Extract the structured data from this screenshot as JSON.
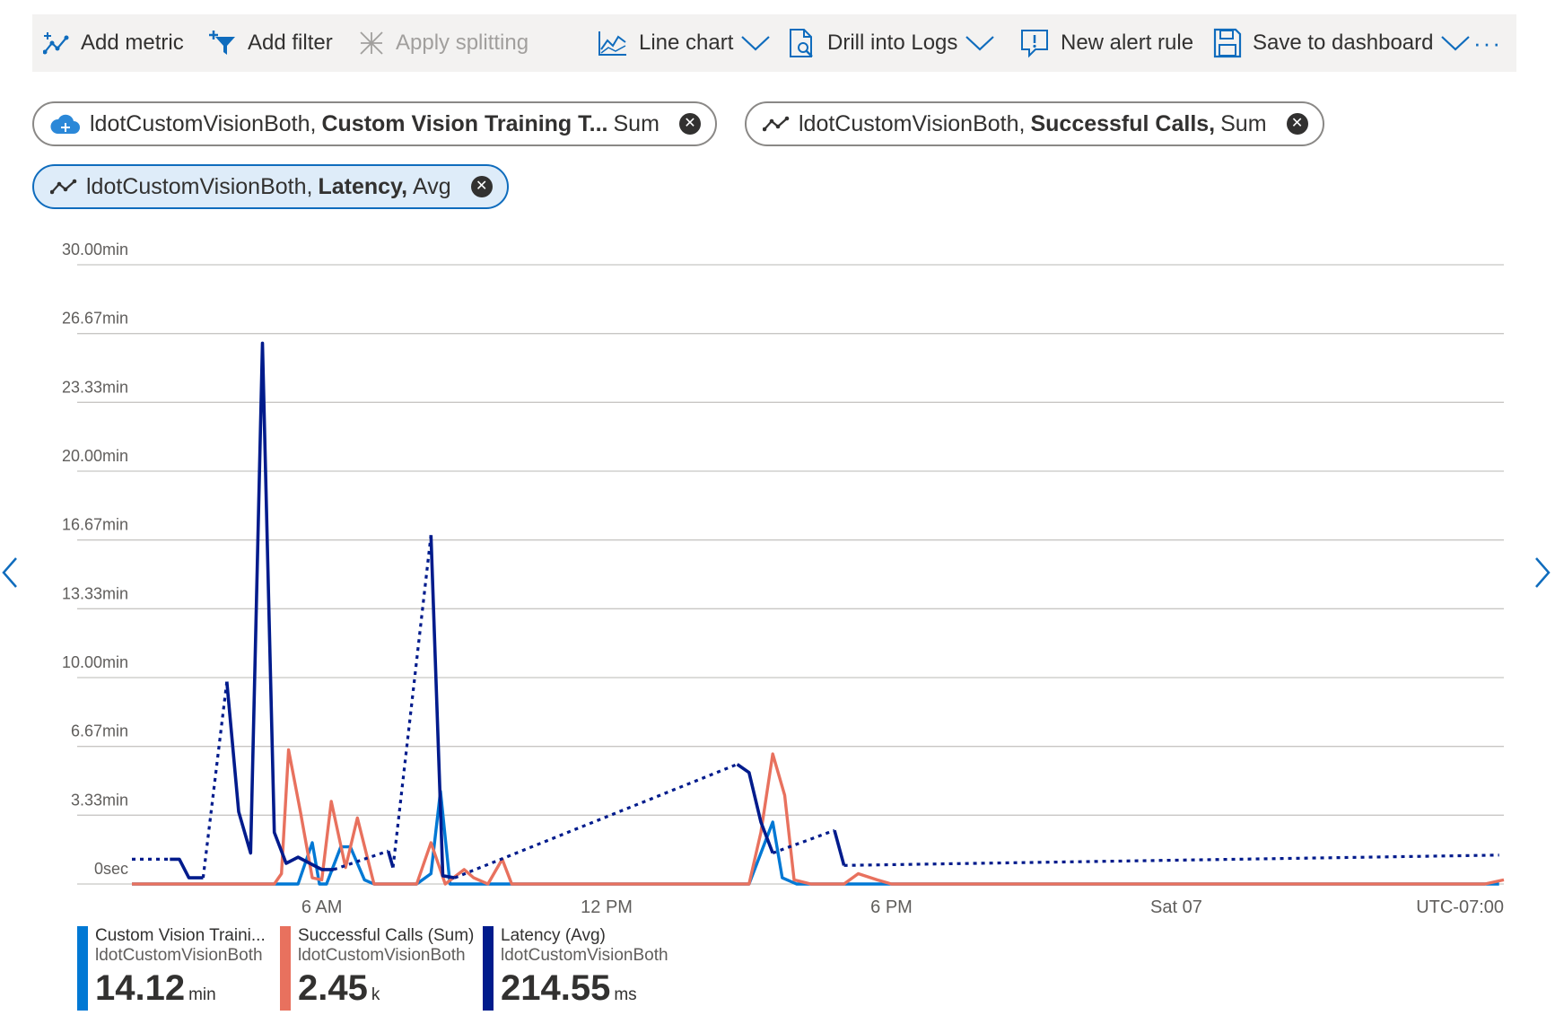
{
  "toolbar": {
    "add_metric": "Add metric",
    "add_filter": "Add filter",
    "apply_splitting": "Apply splitting",
    "line_chart": "Line chart",
    "drill_into_logs": "Drill into Logs",
    "new_alert_rule": "New alert rule",
    "save_to_dashboard": "Save to dashboard",
    "more": "···"
  },
  "pills": [
    {
      "resource": "ldotCustomVisionBoth,",
      "metric": "Custom Vision Training T...",
      "aggregation": "Sum",
      "icon": "cloud-brain-icon"
    },
    {
      "resource": "ldotCustomVisionBoth,",
      "metric": "Successful Calls,",
      "aggregation": "Sum",
      "icon": "metric-line-icon"
    },
    {
      "resource": "ldotCustomVisionBoth,",
      "metric": "Latency,",
      "aggregation": "Avg",
      "icon": "metric-line-icon"
    }
  ],
  "colors": {
    "training": "#0078d4",
    "calls": "#e8715e",
    "latency": "#001b8c",
    "grid": "#c8c6c4"
  },
  "legend": [
    {
      "name": "Custom Vision Traini...",
      "resource": "ldotCustomVisionBoth",
      "value": "14.12",
      "unit": "min"
    },
    {
      "name": "Successful Calls (Sum)",
      "resource": "ldotCustomVisionBoth",
      "value": "2.45",
      "unit": "k"
    },
    {
      "name": "Latency (Avg)",
      "resource": "ldotCustomVisionBoth",
      "value": "214.55",
      "unit": "ms"
    }
  ],
  "chart_data": {
    "type": "line",
    "y_tick_labels": [
      "0sec",
      "3.33min",
      "6.67min",
      "10.00min",
      "13.33min",
      "16.67min",
      "20.00min",
      "23.33min",
      "26.67min",
      "30.00min"
    ],
    "ylim": [
      0,
      30
    ],
    "y_unit": "min",
    "x_tick_labels": [
      "6 AM",
      "12 PM",
      "6 PM",
      "Sat 07",
      "UTC-07:00"
    ],
    "x_ticks_hours": [
      6,
      12,
      18,
      24
    ],
    "xlim_hours": [
      2,
      30.9
    ],
    "grid": true,
    "series": [
      {
        "name": "Custom Vision Training T... (Sum)",
        "style": "solid",
        "x": [
          2,
          5.5,
          5.8,
          5.95,
          6.1,
          6.4,
          6.6,
          6.9,
          7.1,
          8.0,
          8.3,
          8.5,
          8.7,
          9.0,
          9.5,
          10.0,
          15.0,
          15.5,
          15.7,
          16.0,
          17.0,
          18.0,
          30.5,
          30.8
        ],
        "y": [
          0,
          0,
          2,
          0,
          0,
          1.8,
          1.8,
          0.2,
          0,
          0,
          0.5,
          4.5,
          0,
          0,
          0,
          0,
          0,
          3,
          0.3,
          0,
          0,
          0,
          0,
          0
        ]
      },
      {
        "name": "Successful Calls (Sum)",
        "style": "solid",
        "x": [
          2,
          4.0,
          5.0,
          5.15,
          5.3,
          5.55,
          5.8,
          6.0,
          6.2,
          6.5,
          6.75,
          7.1,
          7.5,
          8.0,
          8.3,
          8.6,
          9.0,
          9.2,
          9.5,
          9.8,
          10.0,
          10.3,
          15.0,
          15.25,
          15.5,
          15.75,
          15.95,
          16.3,
          17.0,
          17.3,
          17.7,
          18.0,
          30.5,
          30.9
        ],
        "y": [
          0,
          0,
          0,
          0.5,
          6.5,
          3.5,
          0.3,
          0.2,
          4.0,
          0.8,
          3.2,
          0,
          0,
          0,
          2.0,
          0,
          0.7,
          0.3,
          0,
          1.2,
          0,
          0,
          0,
          2.5,
          6.3,
          4.3,
          0.2,
          0,
          0,
          0.5,
          0.2,
          0,
          0,
          0.2
        ]
      },
      {
        "name": "Latency (Avg)",
        "style": "mixed",
        "segments": [
          {
            "style": "dotted",
            "x": [
              2,
              2.8
            ],
            "y": [
              1.2,
              1.2
            ]
          },
          {
            "style": "solid",
            "x": [
              2.8,
              3.0,
              3.2,
              3.5
            ],
            "y": [
              1.2,
              1.2,
              0.3,
              0.3
            ]
          },
          {
            "style": "dotted",
            "x": [
              3.5,
              4.0
            ],
            "y": [
              0.3,
              9.8
            ]
          },
          {
            "style": "solid",
            "x": [
              4.0,
              4.25,
              4.5,
              4.75,
              5.0,
              5.25,
              5.5,
              5.75,
              6.0,
              6.25
            ],
            "y": [
              9.8,
              3.5,
              1.5,
              26.2,
              2.5,
              1.0,
              1.3,
              1.0,
              0.7,
              0.7
            ]
          },
          {
            "style": "dotted",
            "x": [
              6.25,
              7.4
            ],
            "y": [
              0.7,
              1.6
            ]
          },
          {
            "style": "solid",
            "x": [
              7.4,
              7.5
            ],
            "y": [
              1.6,
              0.8
            ]
          },
          {
            "style": "dotted",
            "x": [
              7.5,
              8.3
            ],
            "y": [
              0.8,
              16.9
            ]
          },
          {
            "style": "solid",
            "x": [
              8.3,
              8.55,
              8.8
            ],
            "y": [
              16.9,
              0.4,
              0.3
            ]
          },
          {
            "style": "dotted",
            "x": [
              8.8,
              14.75
            ],
            "y": [
              0.3,
              5.8
            ]
          },
          {
            "style": "solid",
            "x": [
              14.75,
              15.0,
              15.25,
              15.5
            ],
            "y": [
              5.8,
              5.4,
              3.0,
              1.5
            ]
          },
          {
            "style": "dotted",
            "x": [
              15.5,
              16.8
            ],
            "y": [
              1.5,
              2.6
            ]
          },
          {
            "style": "solid",
            "x": [
              16.8,
              17.0
            ],
            "y": [
              2.6,
              0.9
            ]
          },
          {
            "style": "dotted",
            "x": [
              17.0,
              30.8
            ],
            "y": [
              0.9,
              1.4
            ]
          }
        ]
      }
    ]
  }
}
